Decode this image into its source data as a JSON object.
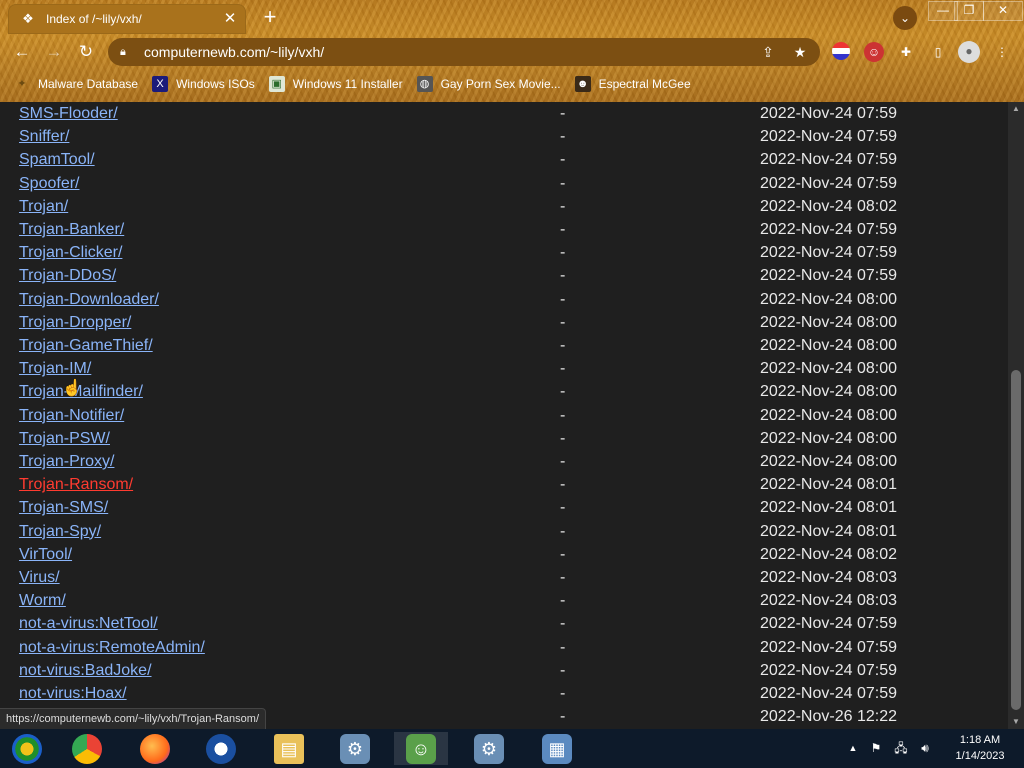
{
  "browser": {
    "tab_title": "Index of /~lily/vxh/",
    "tab_close": "✕",
    "new_tab": "+",
    "url": "computernewb.com/~lily/vxh/",
    "window_controls": {
      "minimize": "—",
      "maximize": "❐",
      "close": "✕"
    }
  },
  "bookmarks": [
    {
      "label": "Malware Database",
      "icon": "scarab-icon"
    },
    {
      "label": "Windows ISOs",
      "icon": "x-logo-icon"
    },
    {
      "label": "Windows 11 Installer",
      "icon": "image-icon"
    },
    {
      "label": "Gay Porn Sex Movie...",
      "icon": "globe-icon"
    },
    {
      "label": "Espectral McGee",
      "icon": "avatar-icon"
    }
  ],
  "listing": [
    {
      "name": "SMS-Flooder/",
      "size": "-",
      "date": "2022-Nov-24 07:59"
    },
    {
      "name": "Sniffer/",
      "size": "-",
      "date": "2022-Nov-24 07:59"
    },
    {
      "name": "SpamTool/",
      "size": "-",
      "date": "2022-Nov-24 07:59"
    },
    {
      "name": "Spoofer/",
      "size": "-",
      "date": "2022-Nov-24 07:59"
    },
    {
      "name": "Trojan/",
      "size": "-",
      "date": "2022-Nov-24 08:02"
    },
    {
      "name": "Trojan-Banker/",
      "size": "-",
      "date": "2022-Nov-24 07:59"
    },
    {
      "name": "Trojan-Clicker/",
      "size": "-",
      "date": "2022-Nov-24 07:59"
    },
    {
      "name": "Trojan-DDoS/",
      "size": "-",
      "date": "2022-Nov-24 07:59"
    },
    {
      "name": "Trojan-Downloader/",
      "size": "-",
      "date": "2022-Nov-24 08:00"
    },
    {
      "name": "Trojan-Dropper/",
      "size": "-",
      "date": "2022-Nov-24 08:00"
    },
    {
      "name": "Trojan-GameThief/",
      "size": "-",
      "date": "2022-Nov-24 08:00"
    },
    {
      "name": "Trojan-IM/",
      "size": "-",
      "date": "2022-Nov-24 08:00"
    },
    {
      "name": "Trojan-Mailfinder/",
      "size": "-",
      "date": "2022-Nov-24 08:00"
    },
    {
      "name": "Trojan-Notifier/",
      "size": "-",
      "date": "2022-Nov-24 08:00"
    },
    {
      "name": "Trojan-PSW/",
      "size": "-",
      "date": "2022-Nov-24 08:00"
    },
    {
      "name": "Trojan-Proxy/",
      "size": "-",
      "date": "2022-Nov-24 08:00"
    },
    {
      "name": "Trojan-Ransom/",
      "size": "-",
      "date": "2022-Nov-24 08:01"
    },
    {
      "name": "Trojan-SMS/",
      "size": "-",
      "date": "2022-Nov-24 08:01"
    },
    {
      "name": "Trojan-Spy/",
      "size": "-",
      "date": "2022-Nov-24 08:01"
    },
    {
      "name": "VirTool/",
      "size": "-",
      "date": "2022-Nov-24 08:02"
    },
    {
      "name": "Virus/",
      "size": "-",
      "date": "2022-Nov-24 08:03"
    },
    {
      "name": "Worm/",
      "size": "-",
      "date": "2022-Nov-24 08:03"
    },
    {
      "name": "not-a-virus:NetTool/",
      "size": "-",
      "date": "2022-Nov-24 07:59"
    },
    {
      "name": "not-a-virus:RemoteAdmin/",
      "size": "-",
      "date": "2022-Nov-24 07:59"
    },
    {
      "name": "not-virus:BadJoke/",
      "size": "-",
      "date": "2022-Nov-24 07:59"
    },
    {
      "name": "not-virus:Hoax/",
      "size": "-",
      "date": "2022-Nov-24 07:59"
    },
    {
      "name": "",
      "size": "-",
      "date": "2022-Nov-26 12:22"
    }
  ],
  "hovered_row": 16,
  "link_color": "#8ab4f8",
  "hover_link_color": "#ff3b30",
  "status_url": "https://computernewb.com/~lily/vxh/Trojan-Ransom/",
  "taskbar": {
    "items": [
      "start-orb-icon",
      "chrome-icon",
      "firefox-icon",
      "obama-logo-icon",
      "folder-icon",
      "setup-icon",
      "people-icon",
      "setup-icon",
      "picture-icon"
    ],
    "active_index": 6,
    "clock_time": "1:18 AM",
    "clock_date": "1/14/2023"
  }
}
